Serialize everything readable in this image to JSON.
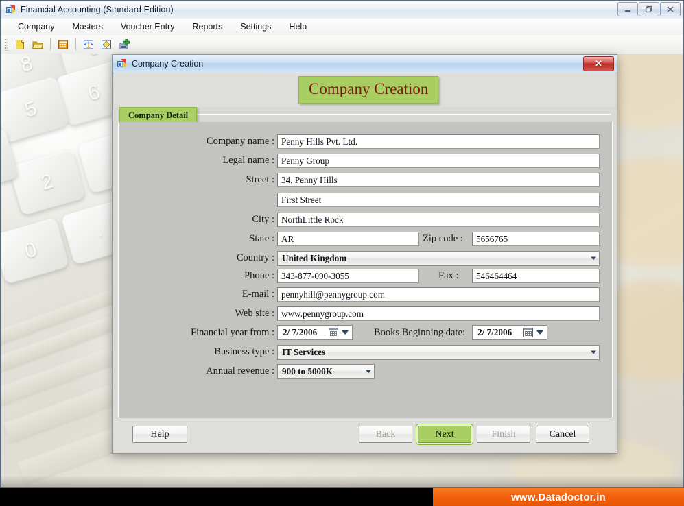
{
  "app": {
    "title": "Financial Accounting (Standard Edition)",
    "icon": "app-icon",
    "window_controls": {
      "minimize": "minimize-icon",
      "restore": "restore-icon",
      "close": "close-icon"
    },
    "menu": [
      {
        "label": "Company"
      },
      {
        "label": "Masters"
      },
      {
        "label": "Voucher Entry"
      },
      {
        "label": "Reports"
      },
      {
        "label": "Settings"
      },
      {
        "label": "Help"
      }
    ],
    "toolbar": [
      {
        "icon": "new-document-icon"
      },
      {
        "icon": "open-folder-icon"
      },
      {
        "icon": "calculator-icon"
      },
      {
        "icon": "balance-scales-icon"
      },
      {
        "icon": "ledger-icon"
      },
      {
        "icon": "add-record-icon"
      }
    ]
  },
  "dialog": {
    "window_title": "Company Creation",
    "icon": "dialog-icon",
    "close_label": "✕",
    "heading": "Company Creation",
    "tab": {
      "label": "Company Detail"
    },
    "colors": {
      "accent_green": "#a9cf62",
      "heading_text": "#7a1a10",
      "footer_orange": "#f2600d",
      "close_red": "#bc2f28"
    },
    "fields": {
      "company_name": {
        "label": "Company name :",
        "value": "Penny Hills Pvt. Ltd."
      },
      "legal_name": {
        "label": "Legal name :",
        "value": "Penny Group"
      },
      "street": {
        "label": "Street :",
        "value": "34, Penny Hills"
      },
      "street2": {
        "label": "",
        "value": "First Street"
      },
      "city": {
        "label": "City :",
        "value": "NorthLittle Rock"
      },
      "state": {
        "label": "State :",
        "value": "AR"
      },
      "zip_code": {
        "label": "Zip code :",
        "value": "5656765"
      },
      "country": {
        "label": "Country :",
        "value": "United Kingdom"
      },
      "phone": {
        "label": "Phone :",
        "value": "343-877-090-3055"
      },
      "fax": {
        "label": "Fax :",
        "value": "546464464"
      },
      "email": {
        "label": "E-mail :",
        "value": "pennyhill@pennygroup.com"
      },
      "website": {
        "label": "Web site :",
        "value": "www.pennygroup.com"
      },
      "financial_year_from": {
        "label": "Financial year from :",
        "value": "2/  7/2006"
      },
      "books_beginning_date": {
        "label": "Books Beginning date:",
        "value": "2/  7/2006"
      },
      "business_type": {
        "label": "Business type :",
        "value": "IT Services"
      },
      "annual_revenue": {
        "label": "Annual revenue :",
        "value": "900 to 5000K"
      }
    },
    "buttons": {
      "help": {
        "label": "Help",
        "state": "enabled"
      },
      "back": {
        "label": "Back",
        "state": "disabled"
      },
      "next": {
        "label": "Next",
        "state": "focused"
      },
      "finish": {
        "label": "Finish",
        "state": "disabled"
      },
      "cancel": {
        "label": "Cancel",
        "state": "enabled"
      }
    }
  },
  "footer": {
    "text": "www.Datadoctor.in"
  }
}
